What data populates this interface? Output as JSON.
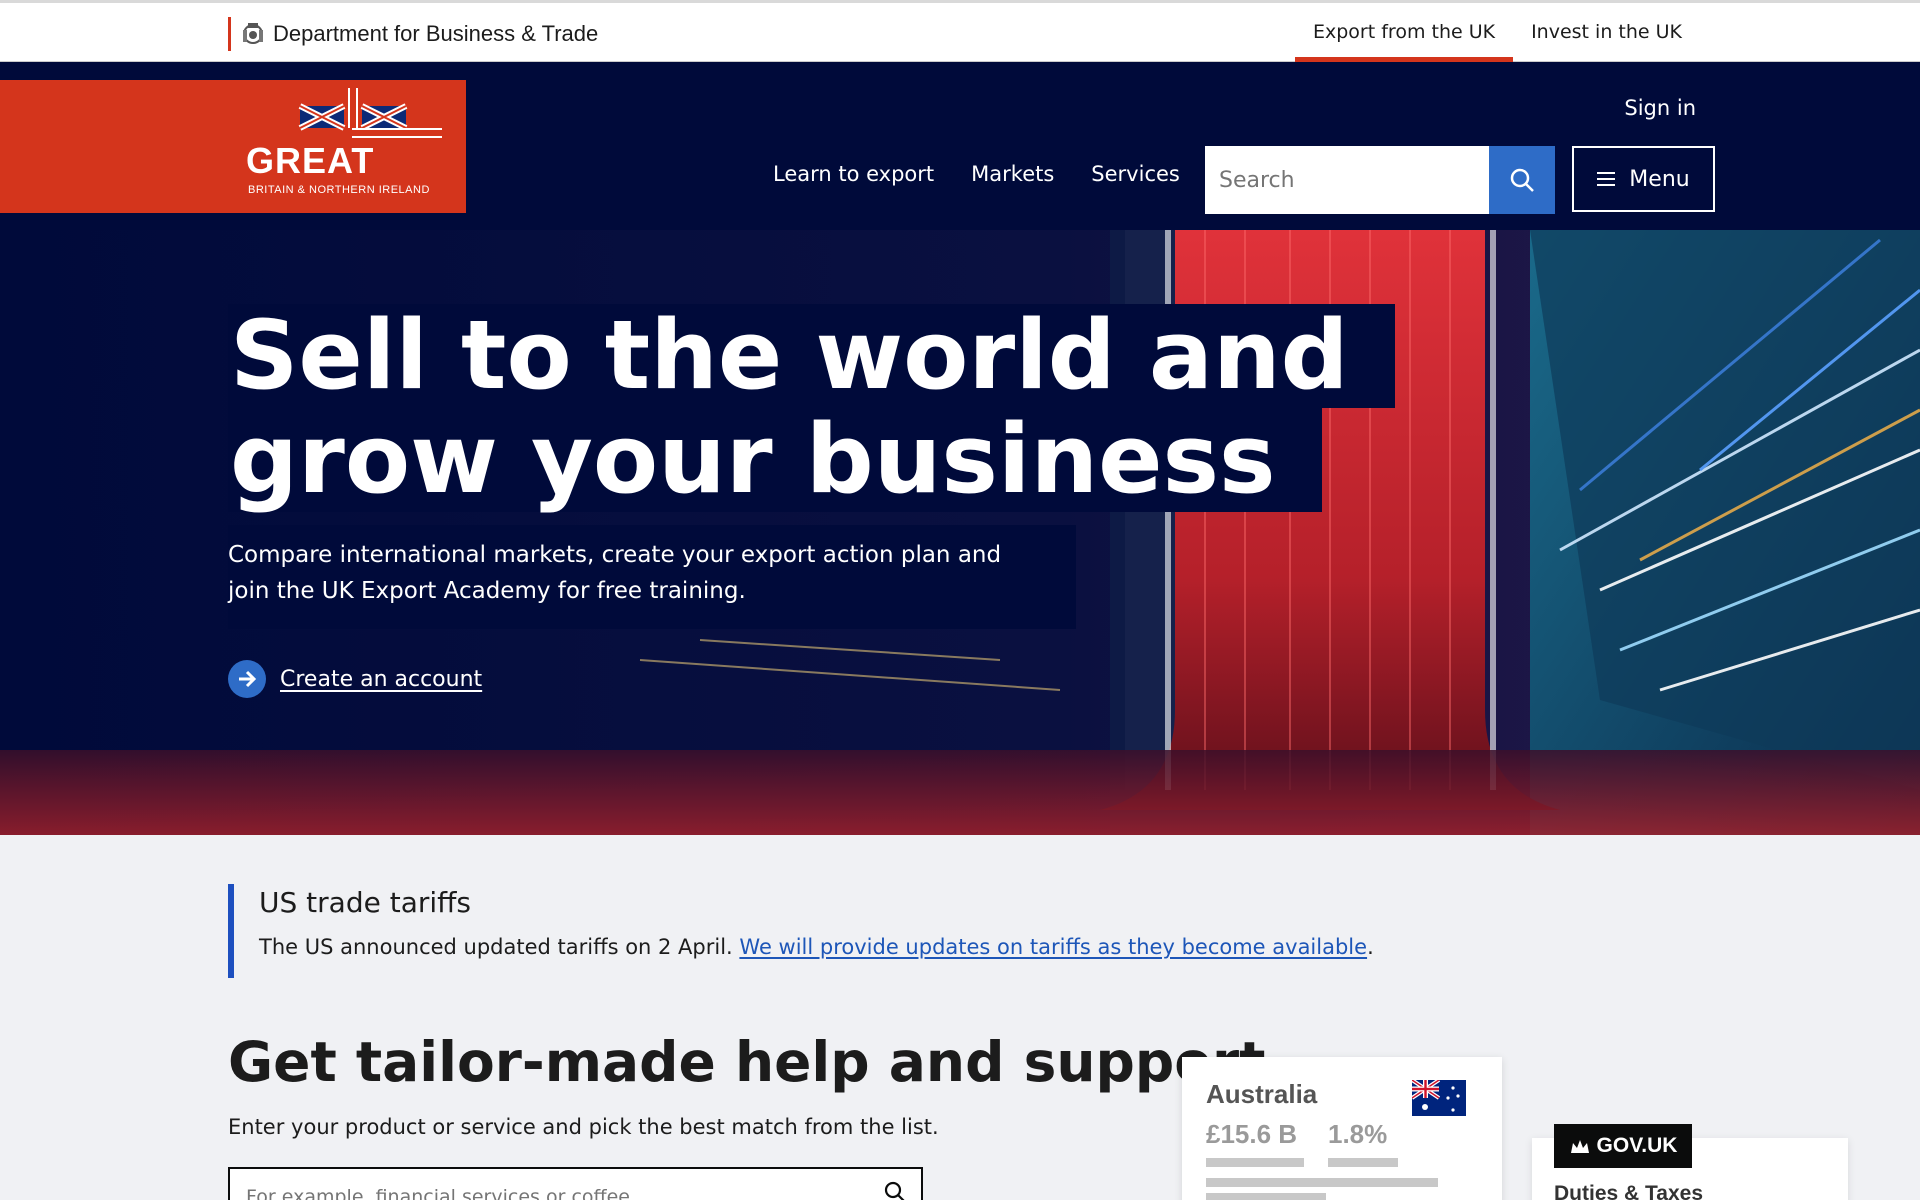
{
  "topbar": {
    "department": "Department for Business & Trade",
    "links": [
      {
        "label": "Export from the UK",
        "active": true
      },
      {
        "label": "Invest in the UK",
        "active": false
      }
    ]
  },
  "header": {
    "logo_great": "GREAT",
    "logo_sub": "BRITAIN & NORTHERN IRELAND",
    "sign_in": "Sign in",
    "nav": [
      "Learn to export",
      "Markets",
      "Services"
    ],
    "search_placeholder": "Search",
    "menu_label": "Menu"
  },
  "hero": {
    "title_line1": "Sell to the world and",
    "title_line2": "grow your business",
    "description": "Compare international markets, create your export action plan and join the UK Export Academy for free training.",
    "cta": "Create an account"
  },
  "notice": {
    "title": "US trade tariffs",
    "body": "The US announced updated tariffs on 2 April. ",
    "link": "We will provide updates on tariffs as they become available",
    "suffix": "."
  },
  "help": {
    "title": "Get tailor-made help and support",
    "description": "Enter your product or service and pick the best match from the list.",
    "input_placeholder": "For example, financial services or coffee"
  },
  "market_card": {
    "country": "Australia",
    "value1": "£15.6 B",
    "value2": "1.8%"
  },
  "gov_card": {
    "badge": "GOV.UK",
    "title": "Duties & Taxes"
  },
  "colors": {
    "navy": "#000a3a",
    "red": "#d4351c",
    "blue": "#2e6cc7",
    "link": "#1d56b8",
    "notice_border": "#1d4fbf"
  }
}
